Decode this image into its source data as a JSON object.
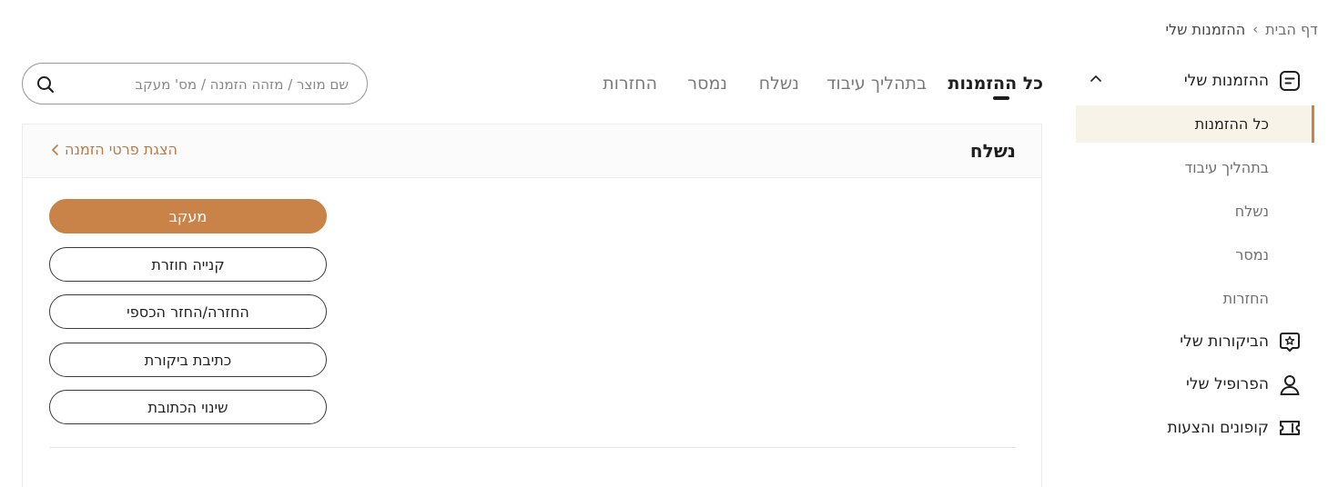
{
  "breadcrumb": {
    "home": "דף הבית",
    "separator": "›",
    "current": "ההזמנות שלי"
  },
  "sidebar": {
    "orders_title": "ההזמנות שלי",
    "sub_items": [
      "כל ההזמנות",
      "בתהליך עיבוד",
      "נשלח",
      "נמסר",
      "החזרות"
    ],
    "reviews_title": "הביקורות שלי",
    "profile_title": "הפרופיל שלי",
    "coupons_title": "קופונים והצעות"
  },
  "tabs": [
    "כל ההזמנות",
    "בתהליך עיבוד",
    "נשלח",
    "נמסר",
    "החזרות"
  ],
  "search": {
    "placeholder": "שם מוצר / מזהה הזמנה / מס' מעקב"
  },
  "order_card": {
    "status": "נשלח",
    "details_link": "הצגת פרטי הזמנה",
    "buttons": [
      "מעקב",
      "קנייה חוזרת",
      "החזרה/החזר הכספי",
      "כתיבת ביקורת",
      "שינוי הכתובת"
    ]
  },
  "colors": {
    "accent": "#c98247",
    "active_bg": "#f8f3e9",
    "link": "#b57b4a"
  }
}
